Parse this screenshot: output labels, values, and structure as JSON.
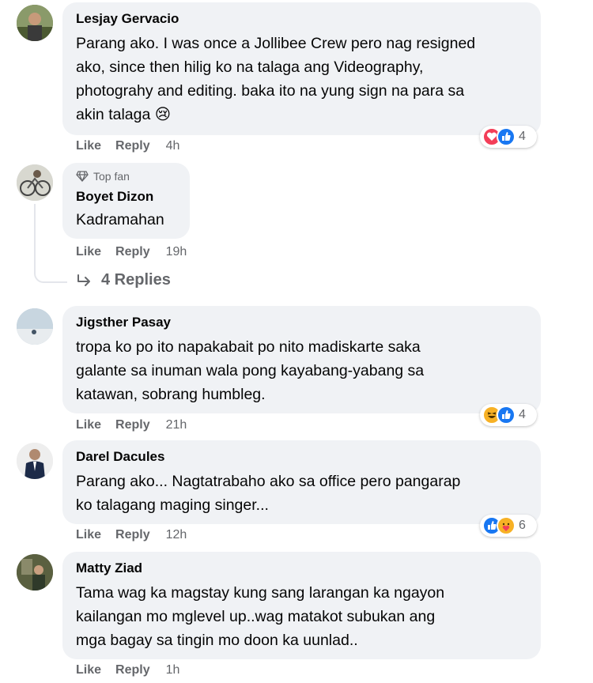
{
  "comments": [
    {
      "name": "Lesjay Gervacio",
      "lines": [
        "Parang ako. I was once a Jollibee Crew pero nag resigned",
        "ako, since then hilig ko na talaga ang Videography,",
        "photograhy and editing. baka ito na yung sign na para sa",
        "akin talaga 😢"
      ],
      "like": "Like",
      "reply": "Reply",
      "time": "4h",
      "reactions": [
        "love",
        "like"
      ],
      "reaction_count": "4"
    },
    {
      "badge": "Top fan",
      "name": "Boyet Dizon",
      "lines": [
        "Kadramahan"
      ],
      "like": "Like",
      "reply": "Reply",
      "time": "19h",
      "replies_label": "4 Replies"
    },
    {
      "name": "Jigsther Pasay",
      "lines": [
        "tropa ko po ito napakabait po nito madiskarte saka",
        "galante sa inuman wala pong kayabang-yabang sa",
        "katawan, sobrang humbleg."
      ],
      "like": "Like",
      "reply": "Reply",
      "time": "21h",
      "reactions": [
        "haha",
        "like"
      ],
      "reaction_count": "4"
    },
    {
      "name": "Darel Dacules",
      "lines": [
        "Parang ako... Nagtatrabaho ako sa office pero pangarap",
        "ko talagang maging singer..."
      ],
      "like": "Like",
      "reply": "Reply",
      "time": "12h",
      "reactions": [
        "like",
        "care"
      ],
      "reaction_count": "6"
    },
    {
      "name": "Matty Ziad",
      "lines": [
        "Tama wag ka magstay kung sang larangan ka ngayon",
        "kailangan mo mglevel up..wag matakot subukan ang",
        "mga bagay sa tingin mo doon ka uunlad.."
      ],
      "like": "Like",
      "reply": "Reply",
      "time": "1h"
    }
  ],
  "colors": {
    "bubble": "#f0f2f5",
    "secondary_text": "#65676b",
    "like_blue": "#1877f2",
    "love_red": "#f33e58",
    "haha_yellow": "#f7b125"
  }
}
